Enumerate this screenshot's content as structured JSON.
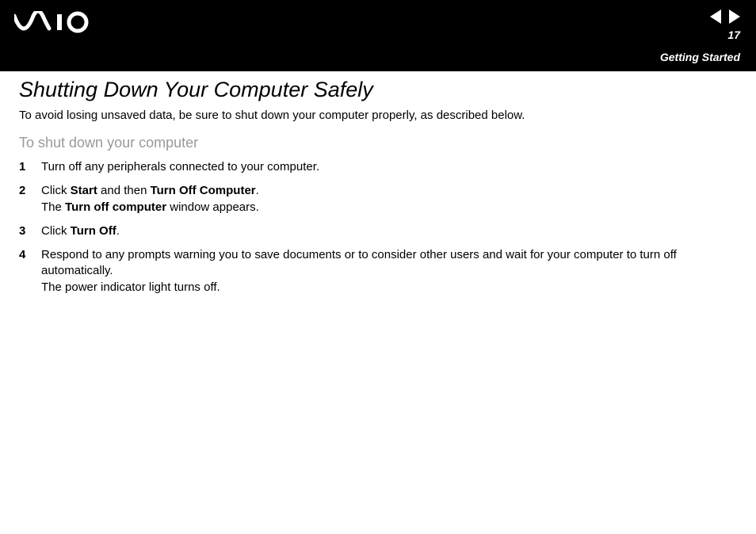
{
  "header": {
    "logo_label": "VAIO",
    "page_number": "17",
    "section": "Getting Started"
  },
  "title": "Shutting Down Your Computer Safely",
  "intro": "To avoid losing unsaved data, be sure to shut down your computer properly, as described below.",
  "subheading": "To shut down your computer",
  "steps": [
    {
      "num": "1",
      "html": "Turn off any peripherals connected to your computer."
    },
    {
      "num": "2",
      "html": "Click <b>Start</b> and then <b>Turn Off Computer</b>.<br>The <b>Turn off computer</b> window appears."
    },
    {
      "num": "3",
      "html": "Click <b>Turn Off</b>."
    },
    {
      "num": "4",
      "html": "Respond to any prompts warning you to save documents or to consider other users and wait for your computer to turn off automatically.<br>The power indicator light turns off."
    }
  ]
}
